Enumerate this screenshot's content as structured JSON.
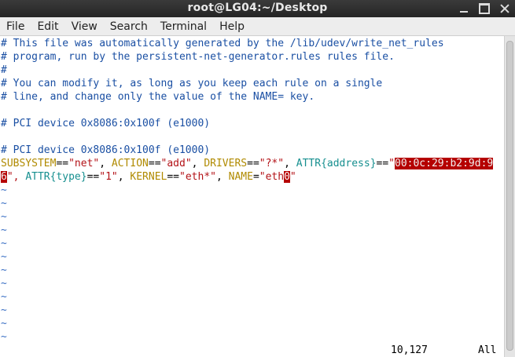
{
  "window": {
    "title": "root@LG04:~/Desktop"
  },
  "menu": [
    "File",
    "Edit",
    "View",
    "Search",
    "Terminal",
    "Help"
  ],
  "editor": {
    "comments": [
      "# This file was automatically generated by the /lib/udev/write_net_rules",
      "# program, run by the persistent-net-generator.rules rules file.",
      "#",
      "# You can modify it, as long as you keep each rule on a single",
      "# line, and change only the value of the NAME= key.",
      "# PCI device 0x8086:0x100f (e1000)",
      "# PCI device 0x8086:0x100f (e1000)"
    ],
    "rule": {
      "subsystem_key": "SUBSYSTEM",
      "subsystem_val": "\"net\"",
      "action_key": "ACTION",
      "action_val": "\"add\"",
      "drivers_key": "DRIVERS",
      "drivers_val": "\"?*\"",
      "attr1": "ATTR",
      "attr1_arg": "address",
      "attr1_val_start": "\"",
      "mac_part1": "00:0c:29:b2:9d:9",
      "mac_part2": "6",
      "attr2_start": "\", ",
      "attr2": "ATTR",
      "attr2_arg": "type",
      "attr2_val": "\"1\"",
      "kernel_key": "KERNEL",
      "kernel_val": "\"eth*\"",
      "name_key": "NAME",
      "name_val_prefix": "\"eth",
      "name_cursor": "0",
      "name_val_suffix": "\""
    },
    "tilde": "~",
    "status": {
      "position": "10,127",
      "scroll": "All"
    }
  },
  "colors": {
    "comment": "#1a4fa3",
    "keyword": "#b08a00",
    "string": "#b31217",
    "attr": "#168f8f",
    "highlight": "#b50000"
  }
}
